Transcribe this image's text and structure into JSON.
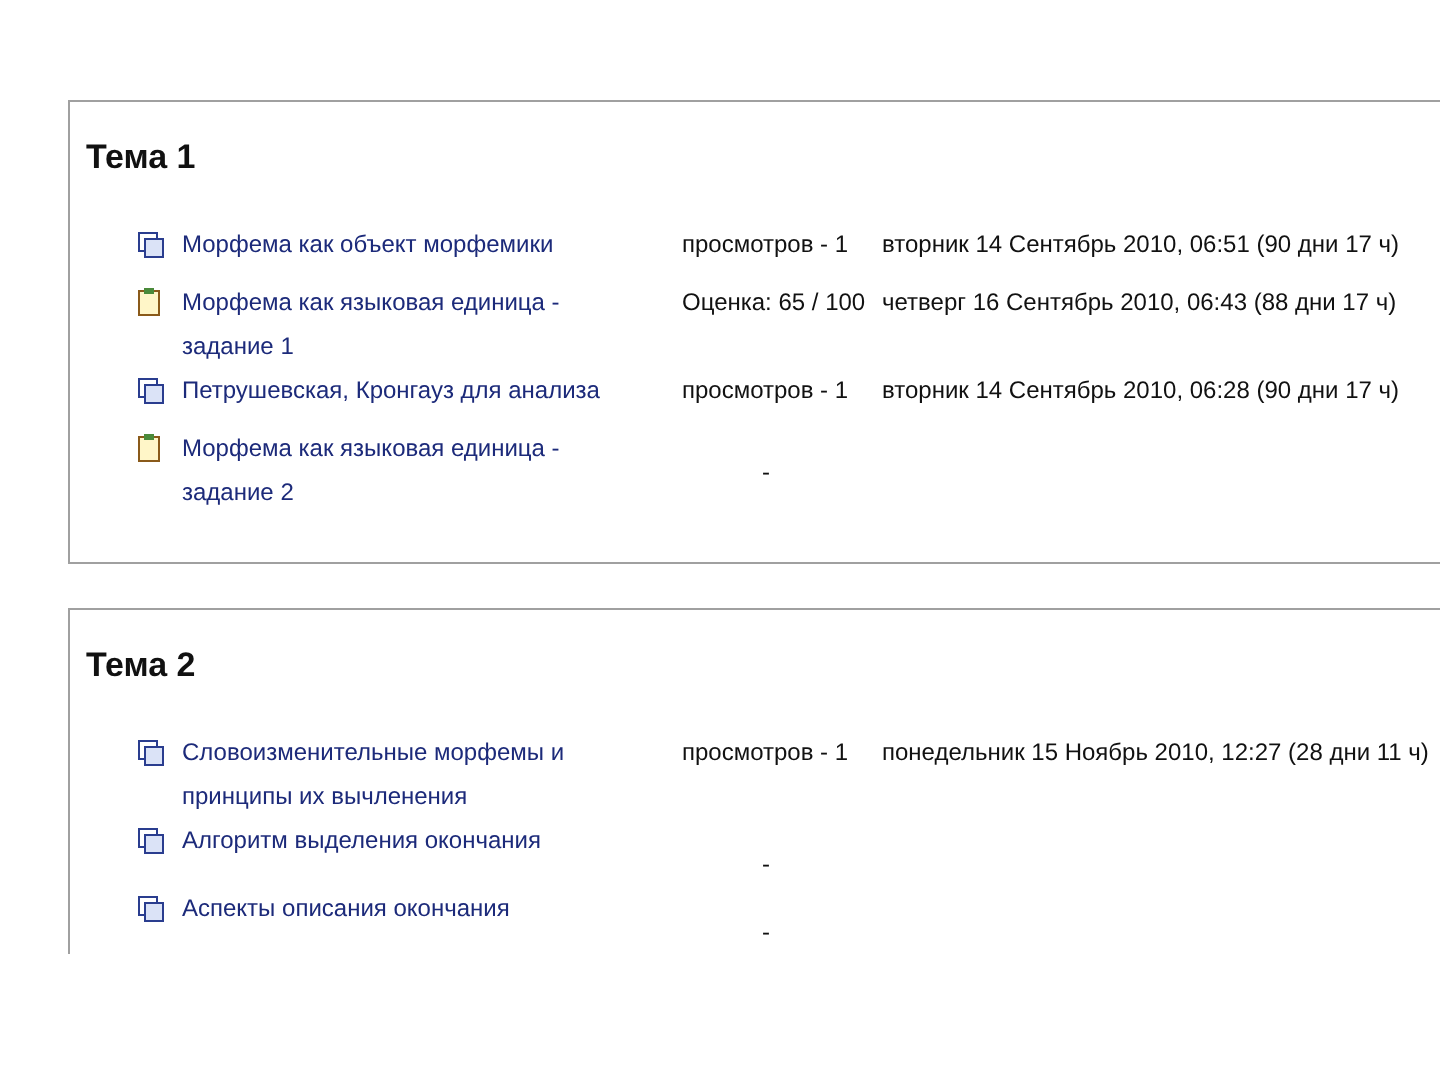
{
  "sections": [
    {
      "title": "Тема 1",
      "closed": true,
      "items": [
        {
          "kind": "resource",
          "name": "Морфема как объект морфемики",
          "info": "просмотров - 1",
          "date": "вторник 14 Сентябрь 2010, 06:51 (90 дни 17 ч)"
        },
        {
          "kind": "assignment",
          "name": "Морфема как языковая единица - задание 1",
          "info": "Оценка: 65 / 100",
          "date": "четверг 16 Сентябрь 2010, 06:43 (88 дни 17 ч)"
        },
        {
          "kind": "resource",
          "name": "Петрушевская, Кронгауз для анализа",
          "info": "просмотров - 1",
          "date": "вторник 14 Сентябрь 2010, 06:28 (90 дни 17 ч)"
        },
        {
          "kind": "assignment",
          "name": "Морфема как языковая единица - задание 2",
          "info": "-"
        }
      ]
    },
    {
      "title": "Тема 2",
      "closed": false,
      "items": [
        {
          "kind": "resource",
          "name": "Словоизменительные морфемы и принципы их вычленения",
          "info": "просмотров - 1",
          "date": "понедельник 15 Ноябрь 2010, 12:27 (28 дни 11 ч)"
        },
        {
          "kind": "resource",
          "name": "Алгоритм выделения окончания",
          "info": "-"
        },
        {
          "kind": "resource",
          "name": "Аспекты описания окончания",
          "info": "-"
        }
      ]
    }
  ]
}
